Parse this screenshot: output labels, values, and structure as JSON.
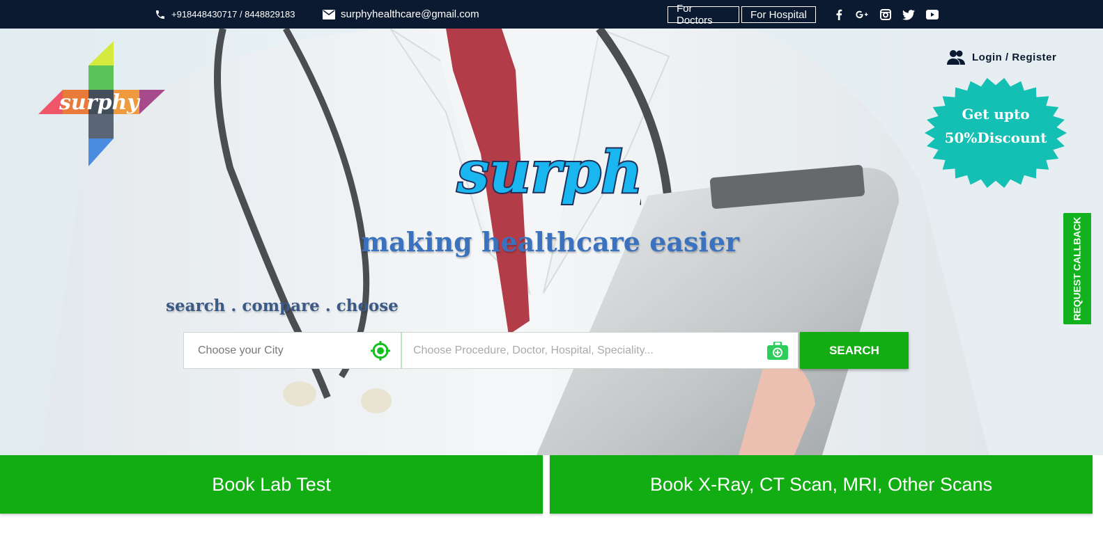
{
  "topbar": {
    "phone": "+918448430717 / 8448829183",
    "email": "surphyhealthcare@gmail.com",
    "for_doctors": "For Doctors",
    "for_hospital": "For Hospital",
    "social": [
      "facebook-icon",
      "google-plus-icon",
      "instagram-icon",
      "twitter-icon",
      "youtube-icon"
    ]
  },
  "hero": {
    "logo_text": "surphy",
    "brand_text": "surphy",
    "tagline": "making healthcare easier",
    "subtagline": "search . compare . choose",
    "login_label": "Login / Register",
    "discount_line1": "Get upto",
    "discount_line2": "50%Discount",
    "request_callback": "REQUEST CALLBACK"
  },
  "search": {
    "city_placeholder": "Choose your City",
    "procedure_placeholder": "Choose Procedure, Doctor, Hospital, Speciality...",
    "button_label": "SEARCH"
  },
  "bookings": {
    "lab": "Book Lab Test",
    "scans": "Book X-Ray, CT Scan, MRI, Other Scans"
  },
  "colors": {
    "topbar": "#0b1a30",
    "green": "#12ad12",
    "teal": "#14bfb3",
    "brand_blue": "#1ab6ef",
    "tagline_blue": "#3a72c0"
  }
}
